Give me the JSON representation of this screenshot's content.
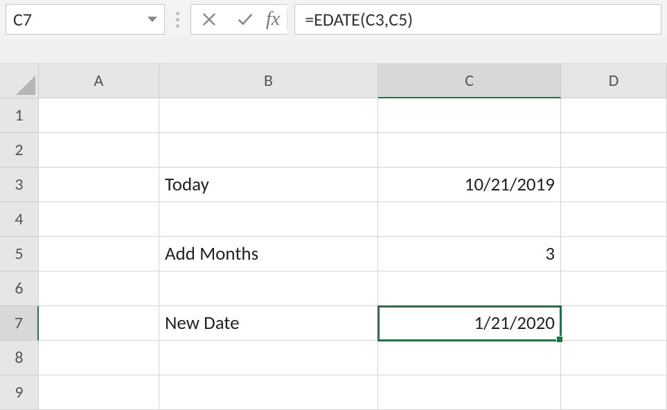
{
  "nameBox": {
    "value": "C7"
  },
  "formulaBar": {
    "fxLabel": "fx",
    "value": "=EDATE(C3,C5)"
  },
  "columns": [
    "A",
    "B",
    "C",
    "D"
  ],
  "rows": [
    "1",
    "2",
    "3",
    "4",
    "5",
    "6",
    "7",
    "8",
    "9"
  ],
  "selected": {
    "col": "C",
    "row": "7"
  },
  "cells": {
    "B3": "Today",
    "C3": "10/21/2019",
    "B5": "Add Months",
    "C5": "3",
    "B7": "New Date",
    "C7": "1/21/2020"
  }
}
